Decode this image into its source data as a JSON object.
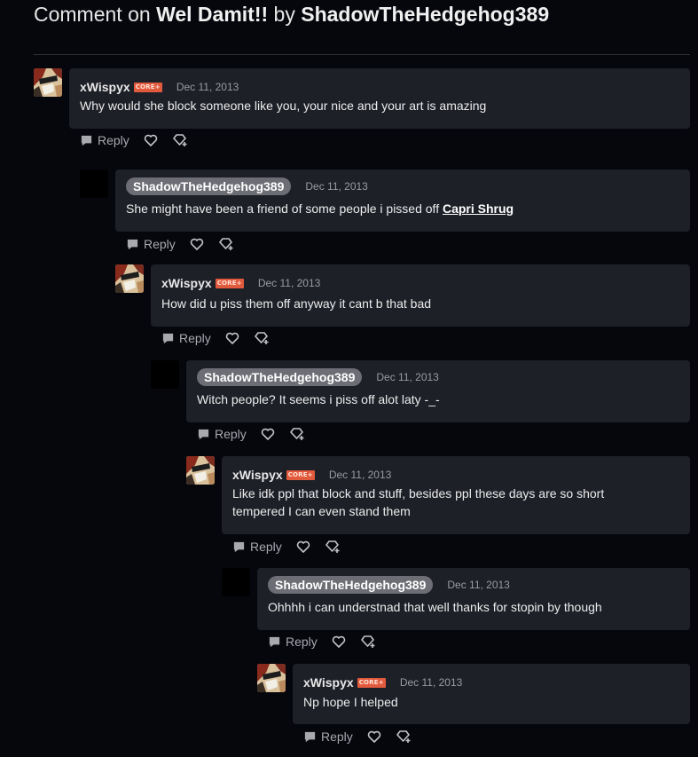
{
  "header": {
    "prefix": "Comment on",
    "deviation_title": "Wel Damit!!",
    "by": "by",
    "author": "ShadowTheHedgehog389"
  },
  "comments": [
    {
      "user": "xWispyx",
      "badge": "CORE+",
      "date": "Dec 11, 2013",
      "text": "Why would she block someone like you, your nice and your art is amazing",
      "reply": "Reply"
    },
    {
      "user": "ShadowTheHedgehog389",
      "date": "Dec 11, 2013",
      "text": "She might have been a friend of some people i pissed off",
      "link": "Capri Shrug",
      "reply": "Reply"
    },
    {
      "user": "xWispyx",
      "badge": "CORE+",
      "date": "Dec 11, 2013",
      "text": "How did u piss them off anyway it cant b that bad",
      "reply": "Reply"
    },
    {
      "user": "ShadowTheHedgehog389",
      "date": "Dec 11, 2013",
      "text": "Witch people? It seems i piss off alot laty -_-",
      "reply": "Reply"
    },
    {
      "user": "xWispyx",
      "badge": "CORE+",
      "date": "Dec 11, 2013",
      "text": "Like idk ppl that block and stuff, besides ppl these days are so short tempered I can even stand them",
      "reply": "Reply"
    },
    {
      "user": "ShadowTheHedgehog389",
      "date": "Dec 11, 2013",
      "text": "Ohhhh i can understnad that well thanks for stopin by though",
      "reply": "Reply"
    },
    {
      "user": "xWispyx",
      "badge": "CORE+",
      "date": "Dec 11, 2013",
      "text": "Np hope I helped",
      "reply": "Reply"
    }
  ]
}
